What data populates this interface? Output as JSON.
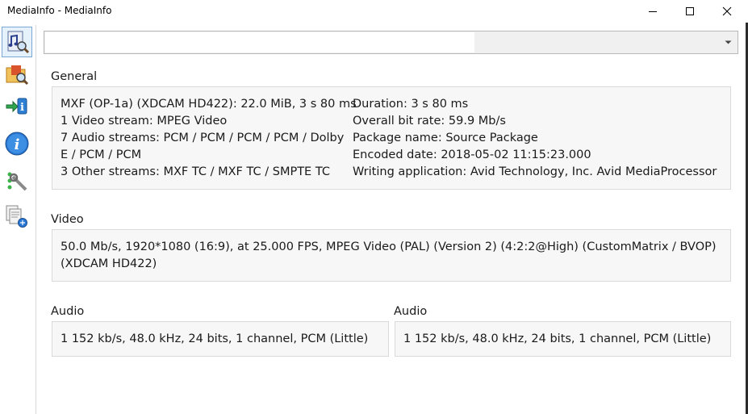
{
  "window": {
    "title": "MediaInfo - MediaInfo"
  },
  "file_select": {
    "value": ""
  },
  "toolbar": {
    "items": [
      {
        "icon": "open-file-icon"
      },
      {
        "icon": "open-folder-icon"
      },
      {
        "icon": "export-icon"
      },
      {
        "icon": "info-icon"
      },
      {
        "icon": "preferences-icon"
      },
      {
        "icon": "sheet-view-icon"
      }
    ]
  },
  "general": {
    "label": "General",
    "left_lines": [
      "MXF (OP-1a) (XDCAM HD422): 22.0 MiB, 3 s 80 ms",
      "1 Video stream: MPEG Video",
      "7 Audio streams: PCM / PCM / PCM / PCM / Dolby",
      "E / PCM / PCM",
      "3 Other streams: MXF TC / MXF TC / SMPTE TC"
    ],
    "right_lines": [
      "Duration: 3 s 80 ms",
      "Overall bit rate: 59.9 Mb/s",
      "Package name: Source Package",
      "Encoded date: 2018-05-02 11:15:23.000",
      "Writing application: Avid Technology, Inc. Avid MediaProcessor"
    ]
  },
  "video": {
    "label": "Video",
    "lines": [
      "50.0 Mb/s, 1920*1080 (16:9), at 25.000 FPS, MPEG Video (PAL) (Version 2) (4:2:2@High) (CustomMatrix / BVOP)",
      "(XDCAM HD422)"
    ]
  },
  "audio": [
    {
      "label": "Audio",
      "text": "1 152 kb/s, 48.0 kHz, 24 bits, 1 channel, PCM (Little)"
    },
    {
      "label": "Audio",
      "text": "1 152 kb/s, 48.0 kHz, 24 bits, 1 channel, PCM (Little)"
    }
  ]
}
